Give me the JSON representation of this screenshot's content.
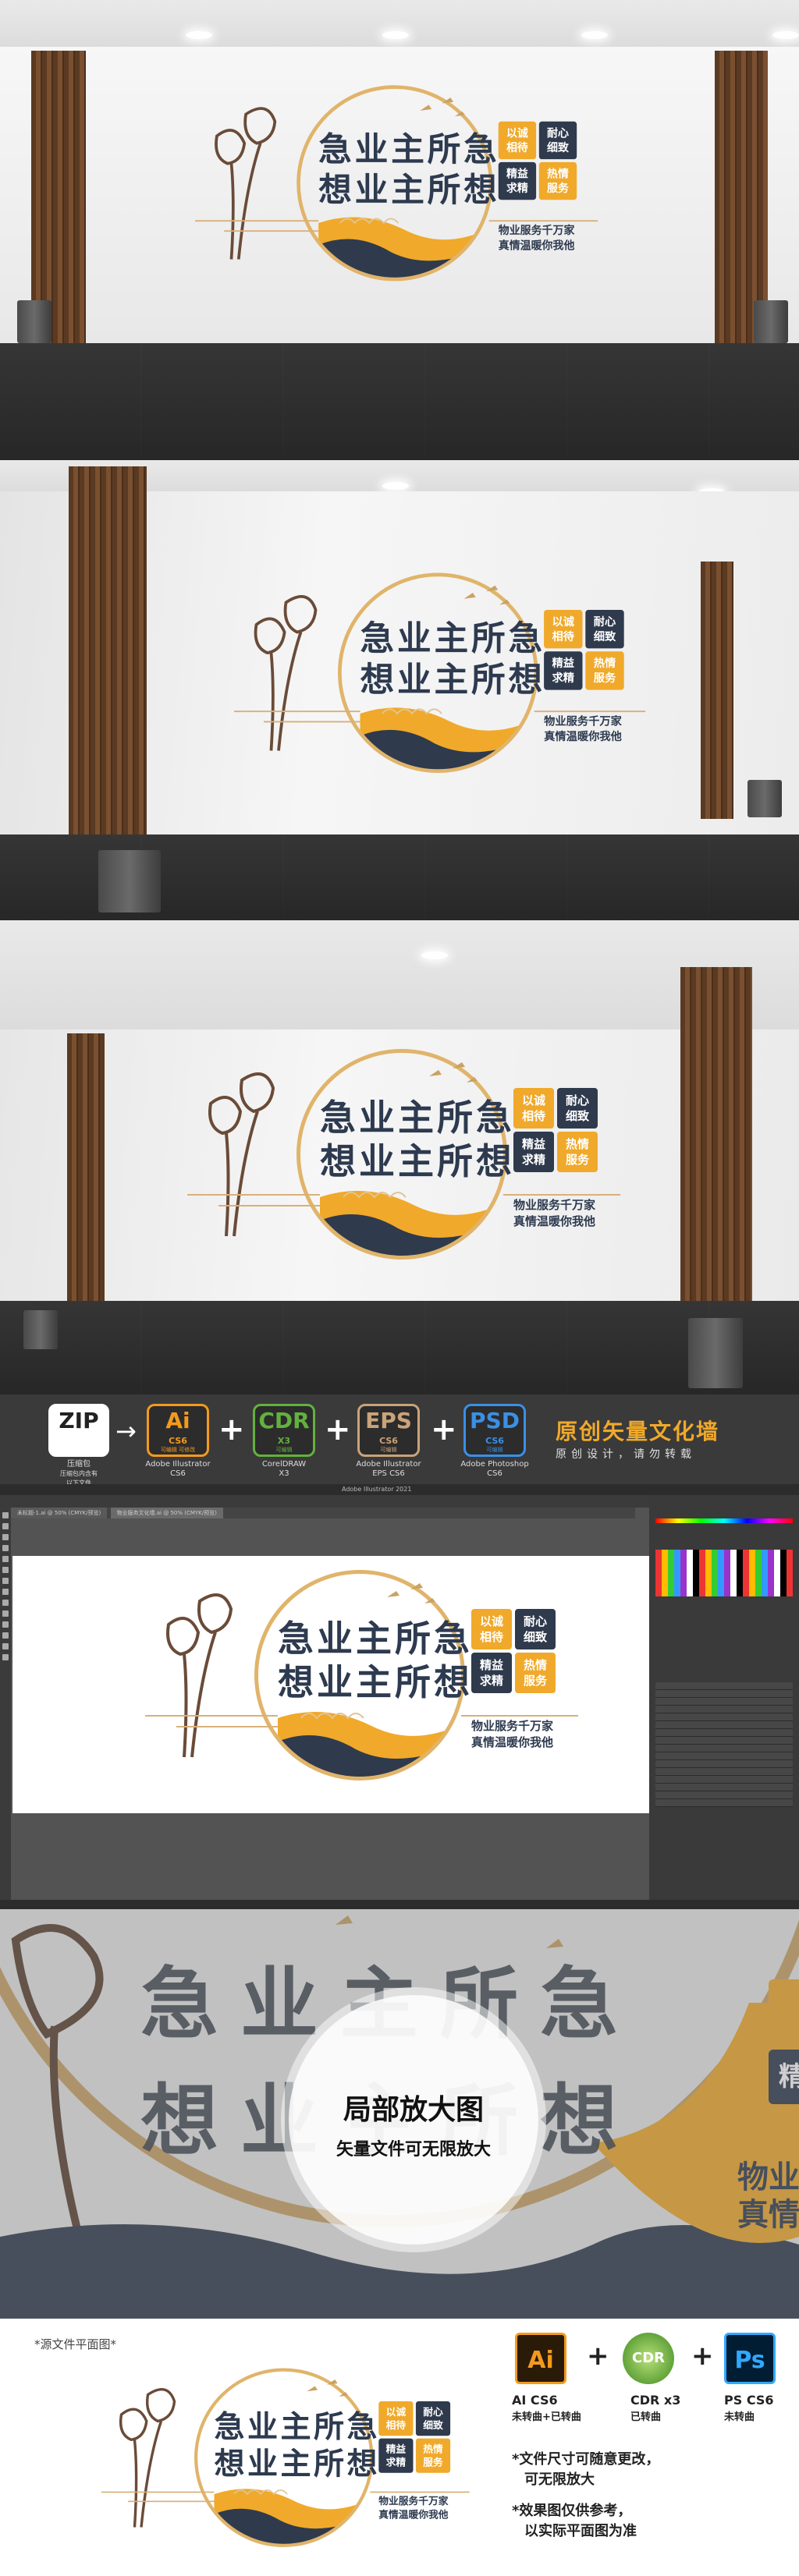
{
  "sign": {
    "title_line1": "急业主所急",
    "title_line2": "想业主所想",
    "tiles": [
      "以诚\n相待",
      "耐心\n细致",
      "精益\n求精",
      "热情\n服务"
    ],
    "slogan_line1": "物业服务千万家",
    "slogan_line2": "真情温暖你我他"
  },
  "banner": {
    "zip_label": "ZIP",
    "zip_caption": "压缩包",
    "zip_note": "压缩包内含有\n以下文件",
    "formats": [
      {
        "code": "Ai",
        "version": "CS6",
        "sub": "可编辑 可修改",
        "caption": "Adobe Illustrator\nCS6",
        "color": "#f29a1e"
      },
      {
        "code": "CDR",
        "version": "X3",
        "sub": "可编辑",
        "caption": "CorelDRAW\nX3",
        "color": "#62b13f"
      },
      {
        "code": "EPS",
        "version": "CS6",
        "sub": "可编辑",
        "caption": "Adobe Illustrator\nEPS CS6",
        "color": "#c9a37a"
      },
      {
        "code": "PSD",
        "version": "CS6",
        "sub": "可编辑",
        "caption": "Adobe Photoshop\nCS6",
        "color": "#3b8fe5"
      }
    ],
    "title": "原创矢量文化墙",
    "subtitle": "原创设计，请勿转载"
  },
  "illustrator": {
    "window_title": "Adobe Illustrator 2021",
    "tab1": "未标题-1.ai @ 50% (CMYK/预览)",
    "tab2": "物业服务文化墙.ai @ 50% (CMYK/预览)"
  },
  "zoom": {
    "bg_line1": "急业主所急",
    "bg_line2": "想业主所想",
    "caption_title": "局部放大图",
    "caption_sub": "矢量文件可无限放大",
    "side_text": "物业\n真情",
    "side_tile": "精"
  },
  "bottom": {
    "source_note": "*源文件平面图*",
    "software": [
      {
        "icon": "Ai",
        "label": "AI CS6",
        "status": "未转曲+已转曲"
      },
      {
        "icon": "CDR",
        "label": "CDR x3",
        "status": "已转曲"
      },
      {
        "icon": "Ps",
        "label": "PS CS6",
        "status": "未转曲"
      }
    ],
    "note1_line1": "*文件尺寸可随意更改，",
    "note1_line2": "可无限放大",
    "note2_line1": "*效果图仅供参考，",
    "note2_line2": "以实际平面图为准"
  }
}
